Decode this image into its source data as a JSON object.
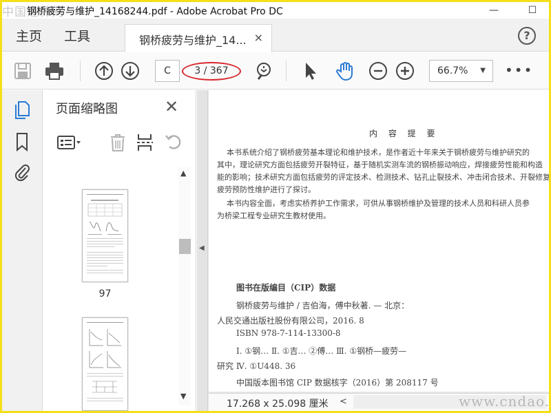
{
  "window": {
    "title": "钢桥疲劳与维护_14168244.pdf - Adobe Acrobat Pro DC",
    "watermark_top": "中国道棉网",
    "minimize": "—",
    "maximize": "☐"
  },
  "menu": {
    "home": "主页",
    "tools": "工具"
  },
  "tab": {
    "label": "钢桥疲劳与维护_14...",
    "close": "×"
  },
  "help": "?",
  "toolbar": {
    "page_input": "C",
    "page_count": "3 / 367",
    "zoom": "66.7%",
    "more": "•••"
  },
  "panel": {
    "title": "页面缩略图",
    "close": "✕",
    "thumbnails": [
      {
        "label": "97"
      },
      {
        "label": ""
      }
    ]
  },
  "document": {
    "heading": "内 容 提 要",
    "summary_lines": [
      "本书系统介绍了钢桥疲劳基本理论和维护技术，是作者近十年来关于钢桥疲劳与维护研究的",
      "其中，理论研究方面包括疲劳开裂特征，基于随机实测车流的钢桥振动响应，焊接疲劳性能和构造",
      "能的影响；技术研究方面包括疲劳的评定技术、检测技术、钻孔止裂技术、冲击闭合技术、开裂修复",
      "疲劳预防性维护进行了探讨。",
      "本书内容全面，考虑实桥养护工作需求，可供从事钢桥维护及管理的技术人员和科研人员参",
      "为桥梁工程专业研究生教材使用。"
    ],
    "cip_title": "图书在版编目（CIP）数据",
    "cip_lines": [
      "钢桥疲劳与维护 / 吉伯海，傅中秋著. — 北京：",
      "人民交通出版社股份有限公司，2016. 8",
      "ISBN  978-7-114-13300-8",
      "Ⅰ. ①钢…   Ⅱ. ①吉… ②傅…   Ⅲ. ①钢桥—疲劳—",
      "研究   Ⅳ. ①U448. 36",
      "中国版本图书馆 CIP 数据核字（2016）第 208117 号"
    ]
  },
  "status": {
    "dimensions": "17.268 x 25.098 厘米",
    "scroll_left": "<"
  },
  "watermark_bottom": "www.cndao.com",
  "colors": {
    "accent_blue": "#2a7ad6",
    "highlight_red": "#d9262b",
    "frame_yellow": "#f4df1a"
  }
}
